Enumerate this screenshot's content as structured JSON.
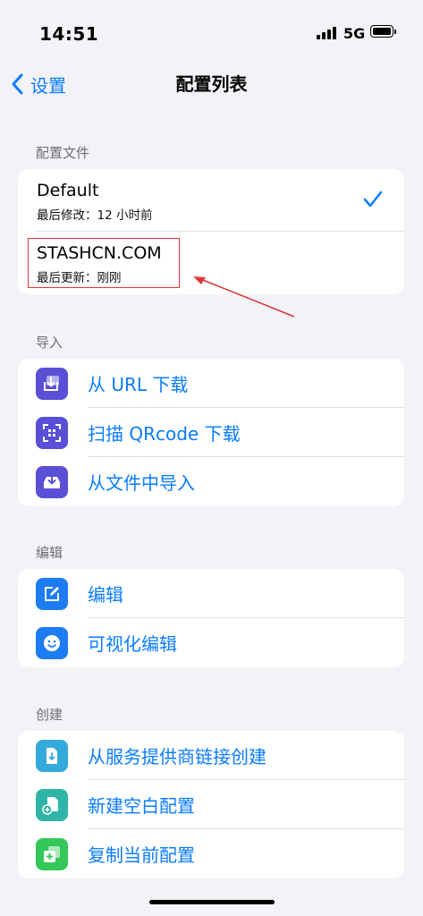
{
  "status": {
    "time": "14:51",
    "network": "5G"
  },
  "nav": {
    "back_label": "设置",
    "title": "配置列表"
  },
  "sections": {
    "profiles": {
      "header": "配置文件",
      "items": [
        {
          "name": "Default",
          "subtitle": "最后修改：12 小时前",
          "selected": true
        },
        {
          "name": "STASHCN.COM",
          "subtitle": "最后更新：刚刚",
          "selected": false
        }
      ]
    },
    "import": {
      "header": "导入",
      "items": [
        {
          "label": "从 URL 下载",
          "icon": "download-tray-icon",
          "color": "#5b4fd8"
        },
        {
          "label": "扫描 QRcode 下载",
          "icon": "qrcode-scan-icon",
          "color": "#5b4fd8"
        },
        {
          "label": "从文件中导入",
          "icon": "inbox-import-icon",
          "color": "#5b4fd8"
        }
      ]
    },
    "edit": {
      "header": "编辑",
      "items": [
        {
          "label": "编辑",
          "icon": "pencil-square-icon",
          "color": "#1e7cf2"
        },
        {
          "label": "可视化编辑",
          "icon": "smiley-icon",
          "color": "#1e7cf2"
        }
      ]
    },
    "create": {
      "header": "创建",
      "items": [
        {
          "label": "从服务提供商链接创建",
          "icon": "document-download-icon",
          "color": "#34aadc"
        },
        {
          "label": "新建空白配置",
          "icon": "document-add-icon",
          "color": "#2fb5a8"
        },
        {
          "label": "复制当前配置",
          "icon": "duplicate-icon",
          "color": "#34c759"
        }
      ]
    }
  },
  "colors": {
    "accent": "#0a7cff",
    "background": "#f2f2f7",
    "annotation": "#e0353a"
  }
}
